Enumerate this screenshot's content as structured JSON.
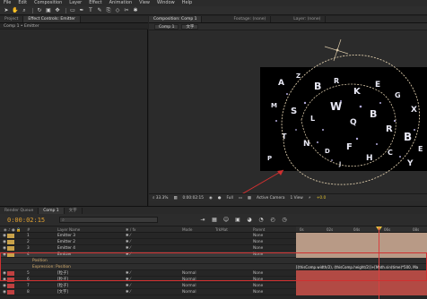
{
  "menu": [
    "File",
    "Edit",
    "Composition",
    "Layer",
    "Effect",
    "Animation",
    "View",
    "Window",
    "Help"
  ],
  "toolbar": {
    "icons": [
      "selection-tool",
      "hand-tool",
      "zoom-tool",
      "rotate-tool",
      "camera-tool",
      "pan-behind-tool",
      "pen-tool",
      "type-tool",
      "brush-tool",
      "clone-tool",
      "eraser-tool",
      "roto-tool",
      "puppet-tool"
    ]
  },
  "left_panel": {
    "tabs": [
      "Project",
      "Effect Controls: Emitter"
    ],
    "subtitle": "Comp 1 • Emitter"
  },
  "comp_panel": {
    "tabs": [
      "Composition: Comp 1",
      "Footage: (none)",
      "Layer: (none)"
    ],
    "chips": [
      "Comp 1",
      "文字"
    ],
    "footer": {
      "zoom": "33.3%",
      "timecode": "0:00:02:15",
      "resolution": "Full",
      "camera": "Active Camera",
      "view": "1 View",
      "offset": "+0.0"
    }
  },
  "timeline": {
    "tabs": [
      "Render Queue",
      "Comp 1",
      "文字"
    ],
    "timecode": "0:00:02:15",
    "search_placeholder": "",
    "columns": {
      "layer_name": "Layer Name",
      "mode": "Mode",
      "trkmat": "TrkMat",
      "parent": "Parent"
    },
    "ruler": [
      "0s",
      "02s",
      "04s",
      "06s",
      "08s"
    ],
    "rows": [
      {
        "num": "1",
        "name": "Emitter 3",
        "parent": "None",
        "color": "#c9a24a",
        "bar": "tan"
      },
      {
        "num": "2",
        "name": "Emitter 2",
        "parent": "None",
        "color": "#c9a24a",
        "bar": "tan"
      },
      {
        "num": "3",
        "name": "Emitter 4",
        "parent": "None",
        "color": "#c9a24a",
        "bar": "tan"
      },
      {
        "num": "4",
        "name": "Emitter",
        "parent": "None",
        "color": "#c9a24a",
        "bar": "tan",
        "selected": true
      },
      {
        "sub": true,
        "name": "Position",
        "value": ""
      },
      {
        "sub": true,
        "name": "Expression: Position",
        "expr": "[(thisComp.width/2), (thisComp.height/2)]+[Math.sin(time)*500, Ma"
      },
      {
        "num": "5",
        "name": "[粒子]",
        "mode": "Normal",
        "parent": "None",
        "color": "#c04040",
        "bar": "red"
      },
      {
        "num": "6",
        "name": "[粒子]",
        "mode": "Normal",
        "parent": "None",
        "color": "#c04040",
        "bar": "red"
      },
      {
        "num": "7",
        "name": "[粒子]",
        "mode": "Normal",
        "parent": "None",
        "color": "#c04040",
        "bar": "red"
      },
      {
        "num": "8",
        "name": "[文字]",
        "mode": "Normal",
        "parent": "None",
        "color": "#c04040",
        "bar": "red"
      }
    ]
  },
  "colors": {
    "accent": "#e0a030",
    "annotation": "#d03030"
  }
}
